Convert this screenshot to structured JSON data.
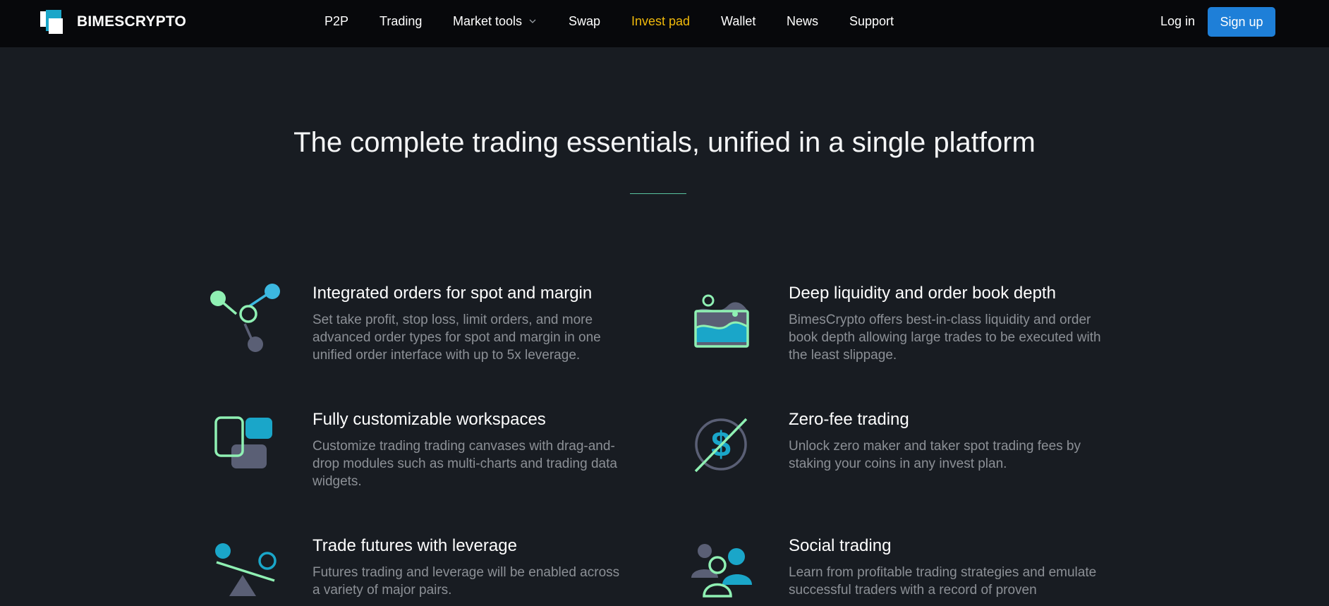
{
  "brand": {
    "name": "BIMESCRYPTO"
  },
  "nav": {
    "items": [
      {
        "label": "P2P"
      },
      {
        "label": "Trading"
      },
      {
        "label": "Market tools",
        "icon": "chevron-down-icon"
      },
      {
        "label": "Swap"
      },
      {
        "label": "Invest pad",
        "active": true
      },
      {
        "label": "Wallet"
      },
      {
        "label": "News"
      },
      {
        "label": "Support"
      }
    ],
    "login_label": "Log in",
    "signup_label": "Sign up"
  },
  "hero": {
    "headline": "The complete trading essentials, unified in a single platform"
  },
  "features": [
    {
      "title": "Integrated orders for spot and margin",
      "description": "Set take profit, stop loss, limit orders, and more advanced order types for spot and margin in one unified order interface with up to 5x leverage.",
      "icon": "network-nodes-icon"
    },
    {
      "title": "Deep liquidity and order book depth",
      "description": "BimesCrypto offers best-in-class liquidity and order book depth allowing large trades to be executed with the least slippage.",
      "icon": "liquidity-wave-icon"
    },
    {
      "title": "Fully customizable workspaces",
      "description": "Customize trading trading canvases with drag-and-drop modules such as multi-charts and trading data widgets.",
      "icon": "workspace-blocks-icon"
    },
    {
      "title": "Zero-fee trading",
      "description": "Unlock zero maker and taker spot trading fees by staking your coins in any invest plan.",
      "icon": "no-fee-dollar-icon"
    },
    {
      "title": "Trade futures with leverage",
      "description": "Futures trading and leverage will be enabled across a variety of major pairs.",
      "icon": "leverage-seesaw-icon"
    },
    {
      "title": "Social trading",
      "description": "Learn from profitable trading strategies and emulate successful traders with a record of proven",
      "icon": "social-users-icon"
    }
  ],
  "colors": {
    "background": "#181c22",
    "topbar": "#07080b",
    "accent_green": "#8ff0b3",
    "accent_blue": "#1aa6c9",
    "active_nav": "#f0b90b",
    "signup_button": "#1e7fd8",
    "muted_text": "#8c9096"
  }
}
